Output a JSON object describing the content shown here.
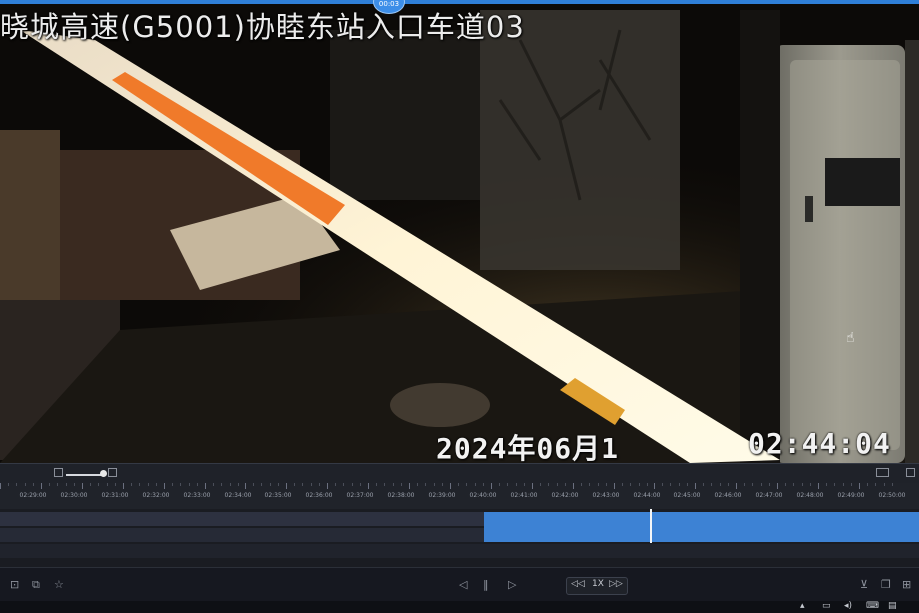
{
  "video": {
    "camera_title": "晓城高速(G5001)协睦东站入口车道03",
    "date_text": "2024年06月1",
    "time_text": "02:44:04",
    "badge": "00:03"
  },
  "toolbar": {
    "left_buttons": [
      "zoom-out-icon",
      "zoom-in-icon"
    ],
    "right_buttons": [
      "screenshot-icon",
      "settings-icon"
    ]
  },
  "timeline": {
    "ticks": [
      "02:29:00",
      "02:30:00",
      "02:31:00",
      "02:32:00",
      "02:33:00",
      "02:34:00",
      "02:35:00",
      "02:36:00",
      "02:37:00",
      "02:38:00",
      "02:39:00",
      "02:40:00",
      "02:41:00",
      "02:42:00",
      "02:43:00",
      "02:44:00",
      "02:45:00",
      "02:46:00",
      "02:47:00",
      "02:48:00",
      "02:49:00",
      "02:50:00"
    ],
    "record_start": "02:40:00",
    "current_time": "02:44:04"
  },
  "controls": {
    "left_icons": [
      "grid-icon",
      "copy-icon",
      "star-icon"
    ],
    "playback": [
      "prev-frame-icon",
      "pause-icon",
      "play-icon"
    ],
    "speed": [
      "◁◁",
      "1X",
      "▷▷"
    ],
    "right_icons": [
      "download-icon",
      "window-icon",
      "fullscreen-icon"
    ]
  },
  "colors": {
    "accent": "#3d82d4",
    "barrier_orange": "#f07a2a",
    "background": "#0b0d12"
  }
}
